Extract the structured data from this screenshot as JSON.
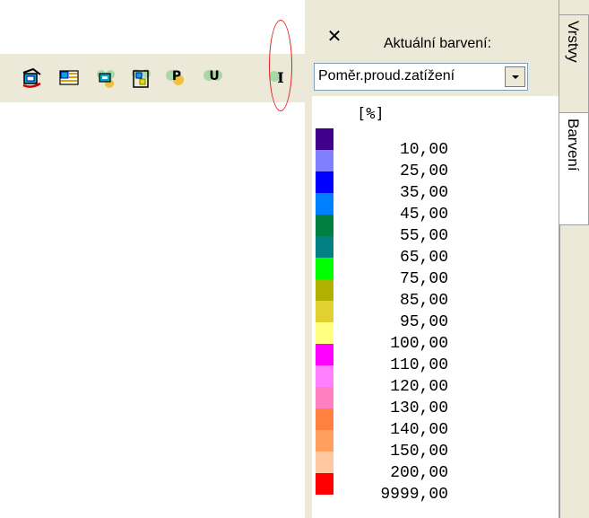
{
  "toolbar": {
    "buttons": [
      {
        "icon": "display-mode-icon"
      },
      {
        "icon": "table-view-icon"
      },
      {
        "icon": "node-view-icon"
      },
      {
        "icon": "structure-view-icon"
      },
      {
        "icon": "power-icon",
        "letter": "P"
      },
      {
        "icon": "voltage-icon",
        "letter": "U"
      },
      {
        "icon": "current-icon",
        "letter": "I"
      }
    ],
    "highlight_color": "#e02020"
  },
  "panel": {
    "close_glyph": "✕",
    "title": "Aktuální barvení:",
    "combo_value": "Poměr.proud.zatížení",
    "unit": "[%]",
    "legend": [
      {
        "color": "#40008a",
        "value": "10,00"
      },
      {
        "color": "#8080ff",
        "value": "25,00"
      },
      {
        "color": "#0000ff",
        "value": "35,00"
      },
      {
        "color": "#0080ff",
        "value": "45,00"
      },
      {
        "color": "#008040",
        "value": "55,00"
      },
      {
        "color": "#008080",
        "value": "65,00"
      },
      {
        "color": "#00ff00",
        "value": "75,00"
      },
      {
        "color": "#b0b000",
        "value": "85,00"
      },
      {
        "color": "#e0d030",
        "value": "95,00"
      },
      {
        "color": "#ffff80",
        "value": "100,00"
      },
      {
        "color": "#ff00ff",
        "value": "110,00"
      },
      {
        "color": "#ff80ff",
        "value": "120,00"
      },
      {
        "color": "#ff80c0",
        "value": "130,00"
      },
      {
        "color": "#ff8040",
        "value": "140,00"
      },
      {
        "color": "#ffa060",
        "value": "150,00"
      },
      {
        "color": "#ffc8a0",
        "value": "200,00"
      },
      {
        "color": "#ff0000",
        "value": "9999,00"
      }
    ]
  },
  "tabs": [
    {
      "label": "Vrstvy"
    },
    {
      "label": "Barvení"
    }
  ]
}
